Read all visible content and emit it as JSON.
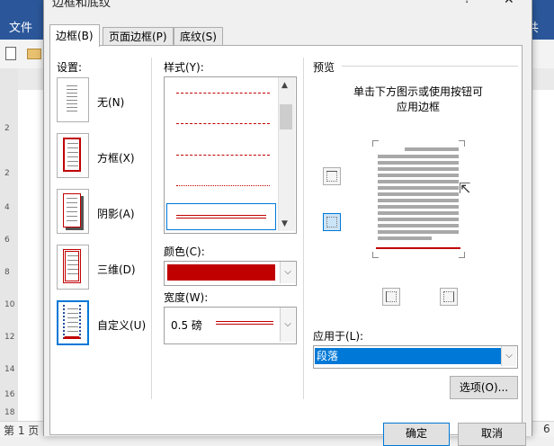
{
  "background_window": {
    "file_tab": "文件",
    "share": "共",
    "status_page": "第 1 页",
    "status_right": "6",
    "ruler_numbers": [
      "2",
      "2",
      "4",
      "6",
      "8",
      "10",
      "12",
      "14",
      "16",
      "18"
    ]
  },
  "dialog": {
    "title": "边框和底纹",
    "help_glyph": "?",
    "close_glyph": "✕",
    "tabs": [
      {
        "label": "边框(B)",
        "active": true
      },
      {
        "label": "页面边框(P)",
        "active": false
      },
      {
        "label": "底纹(S)",
        "active": false
      }
    ],
    "settings": {
      "label": "设置:",
      "items": [
        {
          "label": "无(N)"
        },
        {
          "label": "方框(X)"
        },
        {
          "label": "阴影(A)"
        },
        {
          "label": "三维(D)"
        },
        {
          "label": "自定义(U)",
          "selected": true
        }
      ]
    },
    "style": {
      "label": "样式(Y):"
    },
    "color": {
      "label": "颜色(C):",
      "value_color": "#c00000"
    },
    "width": {
      "label": "宽度(W):",
      "value": "0.5 磅"
    },
    "preview": {
      "label": "预览",
      "hint_line1": "单击下方图示或使用按钮可",
      "hint_line2": "应用边框"
    },
    "apply_to": {
      "label": "应用于(L):",
      "value": "段落"
    },
    "options_button": "选项(O)...",
    "ok_button": "确定",
    "cancel_button": "取消",
    "accent_color": "#0078d7",
    "border_color": "#c00000"
  }
}
